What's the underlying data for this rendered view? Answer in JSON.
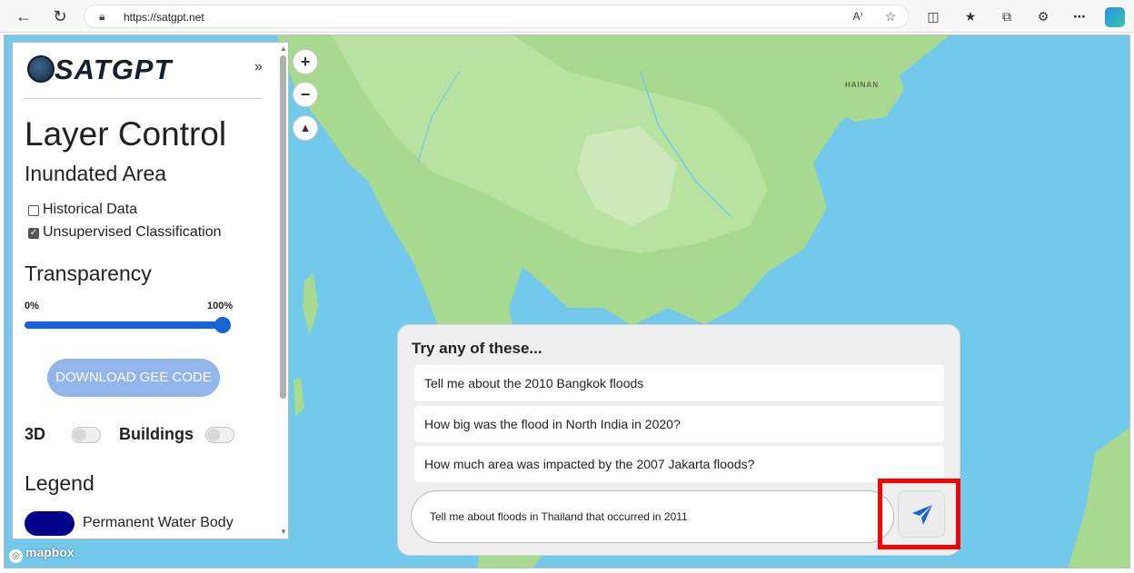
{
  "browser": {
    "url": "https://satgpt.net",
    "back_icon": "arrow-left-icon",
    "reload_icon": "reload-icon",
    "read_aloud_label": "A⁾"
  },
  "panel": {
    "logo_text": "SATGPT",
    "collapse_label": "»",
    "title": "Layer Control",
    "subtitle": "Inundated Area",
    "layers": [
      {
        "label": "Historical Data",
        "checked": false
      },
      {
        "label": "Unsupervised Classification",
        "checked": true
      }
    ],
    "transparency": {
      "title": "Transparency",
      "min_label": "0%",
      "max_label": "100%",
      "value": 1.0
    },
    "download_button": "DOWNLOAD GEE CODE",
    "toggle_3d_label": "3D",
    "toggle_buildings_label": "Buildings",
    "toggle_3d_on": false,
    "toggle_buildings_on": false,
    "legend_title": "Legend",
    "legend_items": [
      {
        "label": "Permanent Water Body",
        "color": "#00008b"
      }
    ]
  },
  "map": {
    "place_label": "HAINAN",
    "zoom_in": "+",
    "zoom_out": "−",
    "compass_icon": "compass-icon",
    "attribution": "mapbox",
    "water_color": "#73c9ec",
    "land_color": "#a7d98f"
  },
  "chat": {
    "title": "Try any of these...",
    "suggestions": [
      "Tell me about the 2010 Bangkok floods",
      "How big was the flood in North India in 2020?",
      "How much area was impacted by the 2007 Jakarta floods?"
    ],
    "input_value": "Tell me about floods in Thailand that occurred in 2011",
    "send_icon": "paper-plane-icon",
    "accent": "#1763d8"
  }
}
